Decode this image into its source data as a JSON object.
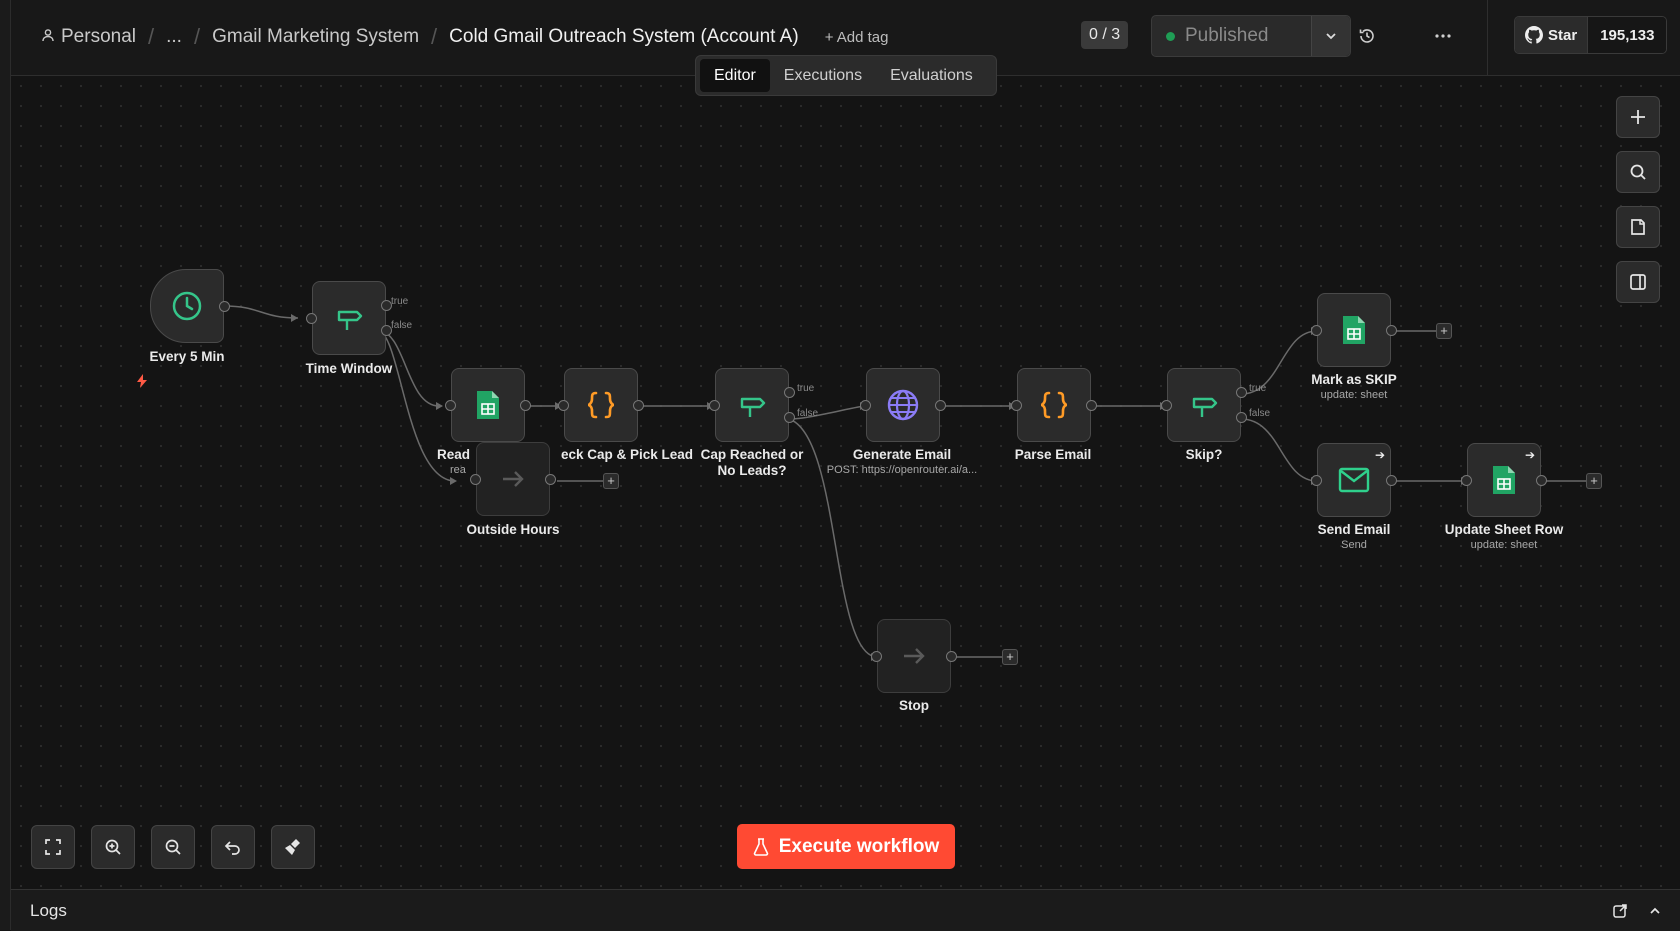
{
  "breadcrumb": {
    "user": "Personal",
    "ellipsis": "...",
    "project": "Gmail Marketing System",
    "workflow": "Cold Gmail Outreach System (Account A)",
    "add_tag": "+ Add tag"
  },
  "header": {
    "counter": "0 / 3",
    "publish_label": "Published",
    "github_star_label": "Star",
    "github_star_count": "195,133",
    "icons": [
      "history-icon",
      "more-horizontal-icon",
      "chevron-down-icon",
      "github-icon"
    ]
  },
  "tabs": [
    {
      "label": "Editor",
      "active": true
    },
    {
      "label": "Executions",
      "active": false
    },
    {
      "label": "Evaluations",
      "active": false
    }
  ],
  "nodes": {
    "every5": {
      "label": "Every 5 Min",
      "icon": "clock-icon"
    },
    "timewindow": {
      "label": "Time Window",
      "icon": "signpost-icon",
      "true": "true",
      "false": "false"
    },
    "readleads": {
      "label": "Read",
      "sub": "rea",
      "icon": "google-sheets-icon"
    },
    "outside": {
      "label": "Outside Hours",
      "icon": "arrow-right-icon"
    },
    "checkcap": {
      "label": "eck Cap & Pick Lead",
      "icon": "code-braces-icon"
    },
    "capreached": {
      "label": "Cap Reached or No Leads?",
      "icon": "signpost-icon",
      "true": "true",
      "false": "false"
    },
    "generate": {
      "label": "Generate Email",
      "sub": "POST: https://openrouter.ai/a...",
      "icon": "globe-icon"
    },
    "parse": {
      "label": "Parse Email",
      "icon": "code-braces-icon"
    },
    "skip": {
      "label": "Skip?",
      "icon": "signpost-icon",
      "true": "true",
      "false": "false"
    },
    "markskip": {
      "label": "Mark as SKIP",
      "sub": "update: sheet",
      "icon": "google-sheets-icon"
    },
    "send": {
      "label": "Send Email",
      "sub": "Send",
      "icon": "mail-icon"
    },
    "update": {
      "label": "Update Sheet Row",
      "sub": "update: sheet",
      "icon": "google-sheets-icon"
    },
    "stop": {
      "label": "Stop",
      "icon": "arrow-right-icon"
    }
  },
  "canvas_tools": [
    "plus-icon",
    "search-icon",
    "sticky-note-icon",
    "panel-icon"
  ],
  "zoom_tools": [
    "fit-view-icon",
    "zoom-in-icon",
    "zoom-out-icon",
    "undo-icon",
    "tidy-up-icon"
  ],
  "execute_button": "Execute workflow",
  "logs": {
    "title": "Logs"
  },
  "colors": {
    "accent": "#ff4a33",
    "published_dot": "#1f9d55",
    "sheets_green": "#21a464",
    "code_orange": "#ff9b26",
    "if_green": "#35c58a",
    "http_purple": "#8b7cf6"
  }
}
